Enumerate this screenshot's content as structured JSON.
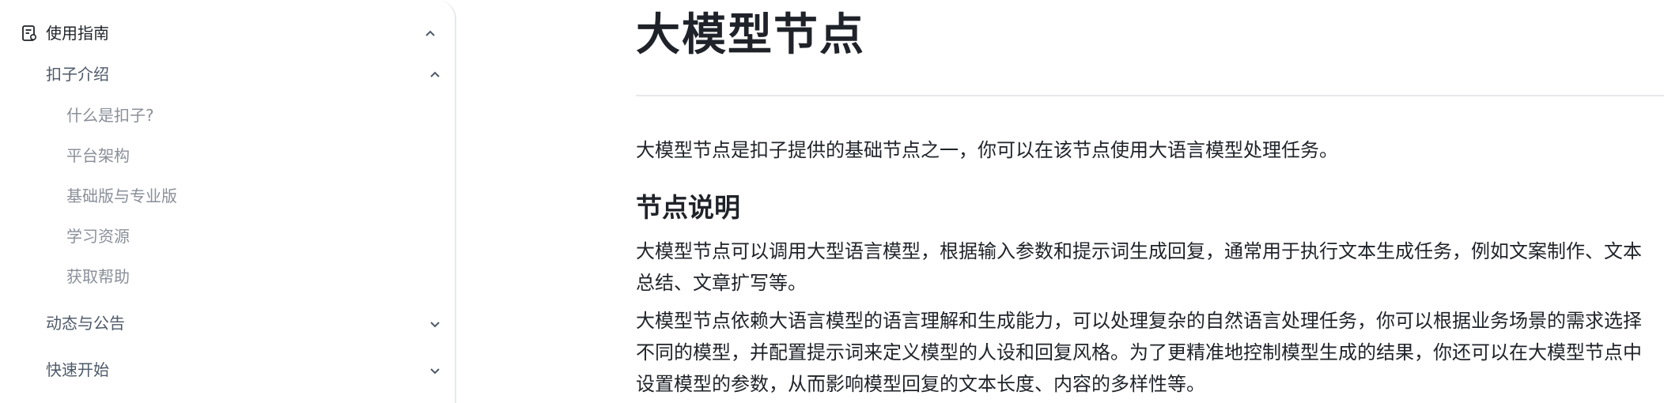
{
  "sidebar": {
    "section": {
      "label": "使用指南",
      "icon": "document-icon",
      "expanded": true
    },
    "items": [
      {
        "label": "扣子介绍",
        "expanded": true,
        "children": [
          {
            "label": "什么是扣子?"
          },
          {
            "label": "平台架构"
          },
          {
            "label": "基础版与专业版"
          },
          {
            "label": "学习资源"
          },
          {
            "label": "获取帮助"
          }
        ]
      },
      {
        "label": "动态与公告",
        "expanded": false
      },
      {
        "label": "快速开始",
        "expanded": false
      }
    ]
  },
  "main": {
    "title": "大模型节点",
    "intro": "大模型节点是扣子提供的基础节点之一，你可以在该节点使用大语言模型处理任务。",
    "section_heading": "节点说明",
    "paragraph1": "大模型节点可以调用大型语言模型，根据输入参数和提示词生成回复，通常用于执行文本生成任务，例如文案制作、文本总结、文章扩写等。",
    "paragraph2": "大模型节点依赖大语言模型的语言理解和生成能力，可以处理复杂的自然语言处理任务，你可以根据业务场景的需求选择不同的模型，并配置提示词来定义模型的人设和回复风格。为了更精准地控制模型生成的结果，你还可以在大模型节点中设置模型的参数，从而影响模型回复的文本长度、内容的多样性等。"
  },
  "colors": {
    "text_primary": "#1f2329",
    "text_secondary": "#4e5969",
    "text_muted": "#8a8f99",
    "border": "#e6e8eb"
  }
}
